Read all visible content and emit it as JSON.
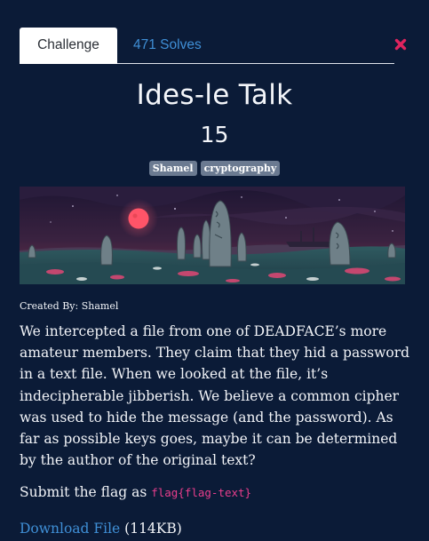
{
  "tabs": {
    "challenge_label": "Challenge",
    "solves_label": "471 Solves"
  },
  "challenge": {
    "title": "Ides-le Talk",
    "points": "15",
    "tags": [
      "Shamel",
      "cryptography"
    ],
    "created_by": "Created By: Shamel",
    "description": "We intercepted a file from one of DEADFACE’s more amateur members. They claim that they hid a password in a text file. When we looked at the file, it’s indecipherable jibberish. We believe a common cipher was used to hide the message (and the password). As far as possible keys goes, maybe it can be determined by the author of the original text?",
    "submit_prefix": "Submit the flag as ",
    "flag_format": "flag{flag-text}",
    "download_label": "Download File",
    "download_size": " (114KB)"
  },
  "icons": {
    "close": "close-x-icon"
  },
  "colors": {
    "background": "#0b1b37",
    "link": "#3f8fd6",
    "code": "#e83e8c",
    "tag_bg": "#6b7a91",
    "close": "#e0245e"
  }
}
